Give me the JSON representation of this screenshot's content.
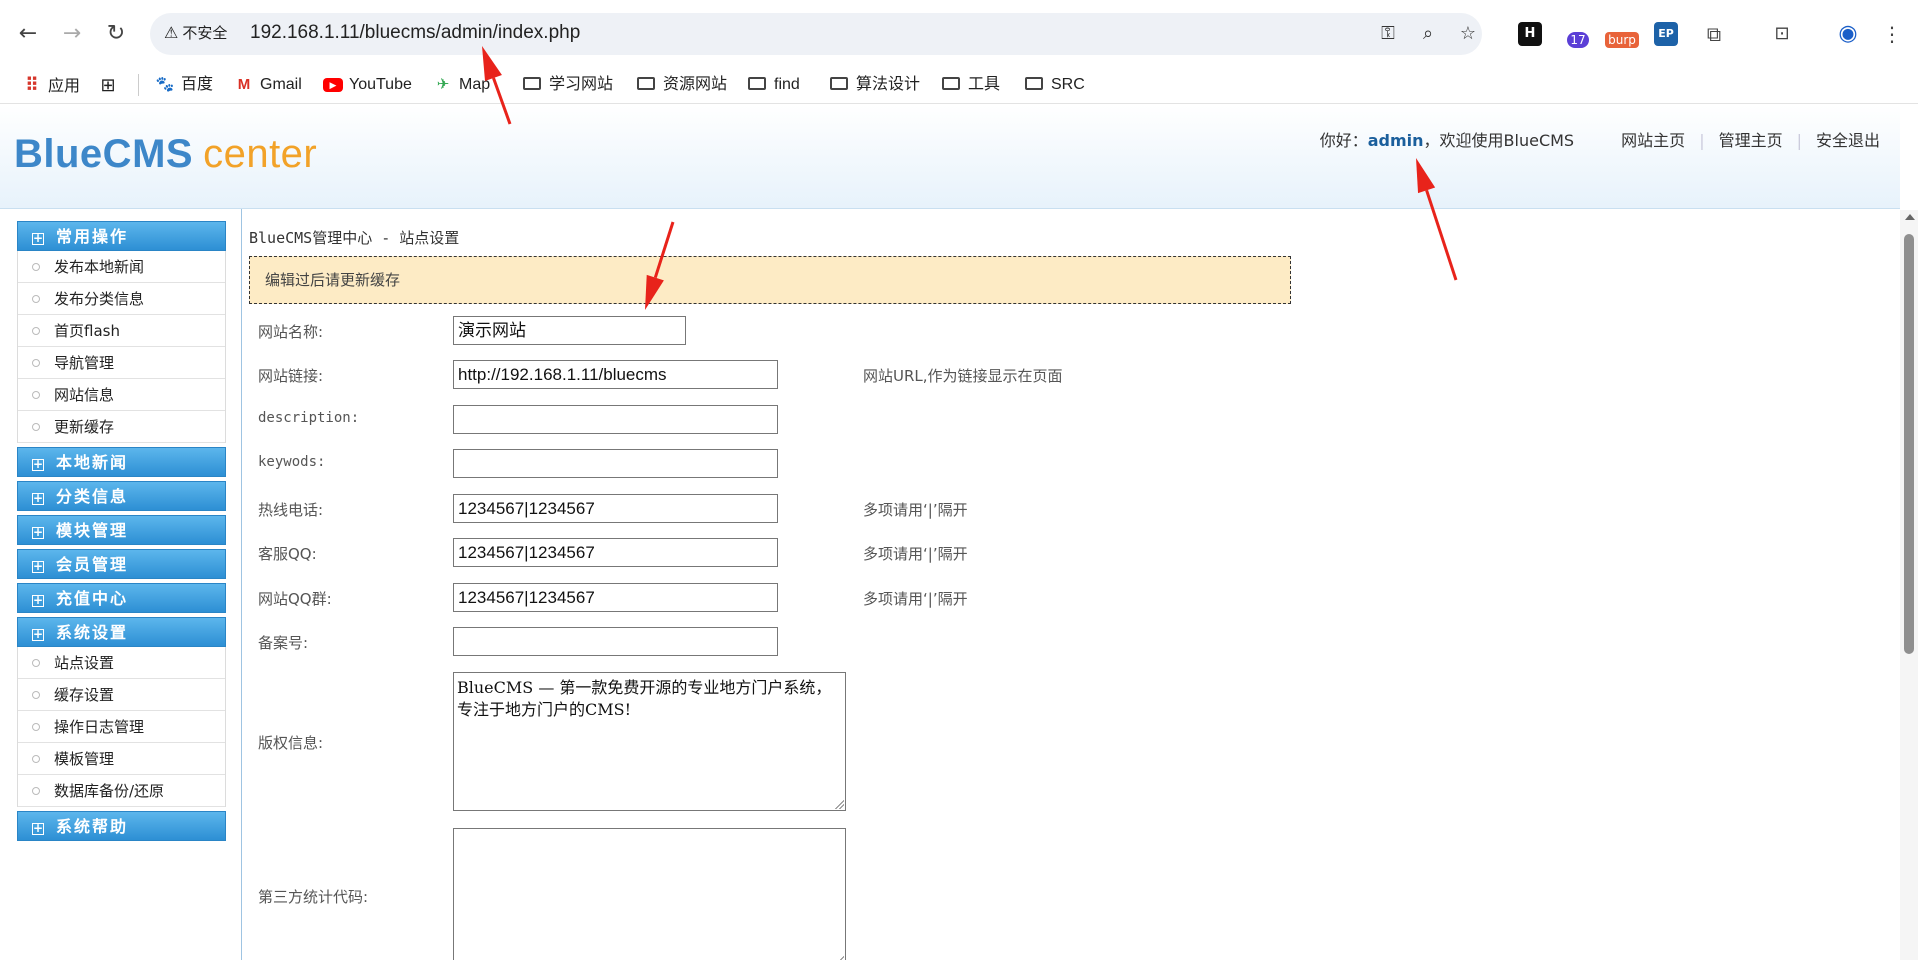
{
  "browser": {
    "security_label": "不安全",
    "url": "192.168.1.11/bluecms/admin/index.php",
    "extensions": [
      {
        "label": "H",
        "color": "#111111"
      },
      {
        "label": "17",
        "color": "#5b3fd6"
      },
      {
        "label": "burp",
        "color": "#e8633a"
      },
      {
        "label": "EP",
        "color": "#1d62a8"
      }
    ]
  },
  "bookmarks": [
    {
      "label": "应用",
      "icon": "apps-grid-icon"
    },
    {
      "label": "",
      "icon": "tab-groups-icon"
    },
    {
      "label": "百度",
      "icon": "baidu-icon"
    },
    {
      "label": "Gmail",
      "icon": "gmail-icon"
    },
    {
      "label": "YouTube",
      "icon": "youtube-icon"
    },
    {
      "label": "Map",
      "icon": "maps-icon"
    },
    {
      "label": "学习网站",
      "icon": "folder-icon"
    },
    {
      "label": "资源网站",
      "icon": "folder-icon"
    },
    {
      "label": "find",
      "icon": "folder-icon"
    },
    {
      "label": "算法设计",
      "icon": "folder-icon"
    },
    {
      "label": "工具",
      "icon": "folder-icon"
    },
    {
      "label": "SRC",
      "icon": "folder-icon"
    }
  ],
  "header": {
    "logo_main": "BlueCMS",
    "logo_sub": "center",
    "greeting": "你好：",
    "username": "admin",
    "welcome": "，欢迎使用BlueCMS",
    "nav": [
      "网站主页",
      "管理主页",
      "安全退出"
    ]
  },
  "sidebar": {
    "groups": [
      {
        "label": "常用操作",
        "items": [
          "发布本地新闻",
          "发布分类信息",
          "首页flash",
          "导航管理",
          "网站信息",
          "更新缓存"
        ]
      },
      {
        "label": "本地新闻",
        "items": []
      },
      {
        "label": "分类信息",
        "items": []
      },
      {
        "label": "模块管理",
        "items": []
      },
      {
        "label": "会员管理",
        "items": []
      },
      {
        "label": "充值中心",
        "items": []
      },
      {
        "label": "系统设置",
        "items": [
          "站点设置",
          "缓存设置",
          "操作日志管理",
          "模板管理",
          "数据库备份/还原"
        ]
      },
      {
        "label": "系统帮助",
        "items": []
      }
    ]
  },
  "main": {
    "breadcrumb": "BlueCMS管理中心 - 站点设置",
    "notice": "编辑过后请更新缓存",
    "fields": {
      "site_name": {
        "label": "网站名称:",
        "value": "演示网站"
      },
      "site_url": {
        "label": "网站链接:",
        "value": "http://192.168.1.11/bluecms",
        "hint": "网站URL,作为链接显示在页面"
      },
      "description": {
        "label": "description:",
        "value": ""
      },
      "keywords": {
        "label": "keywods:",
        "value": ""
      },
      "hotline": {
        "label": "热线电话:",
        "value": "1234567|1234567",
        "hint": "多项请用‘|’隔开"
      },
      "service_qq": {
        "label": "客服QQ:",
        "value": "1234567|1234567",
        "hint": "多项请用‘|’隔开"
      },
      "qq_group": {
        "label": "网站QQ群:",
        "value": "1234567|1234567",
        "hint": "多项请用‘|’隔开"
      },
      "icp": {
        "label": "备案号:",
        "value": ""
      },
      "copyright": {
        "label": "版权信息:",
        "value": "BlueCMS — 第一款免费开源的专业地方门户系统，专注于地方门户的CMS!"
      },
      "stats_code": {
        "label": "第三方统计代码:",
        "value": ""
      }
    }
  },
  "annotation_color": "#e8231b"
}
